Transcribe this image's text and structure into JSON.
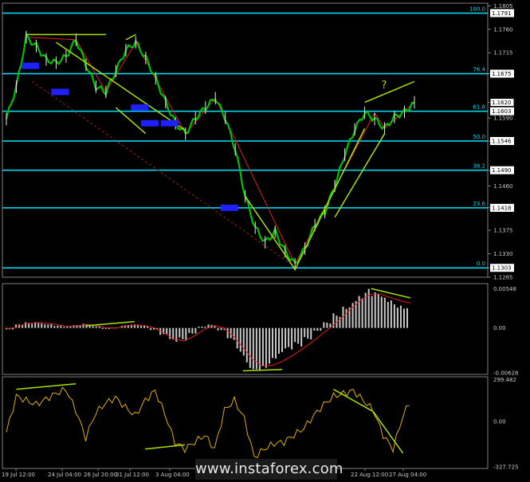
{
  "chart_data": [
    {
      "type": "line",
      "title": "",
      "price_ticks": [
        "1.1805",
        "1.1760",
        "1.1715",
        "1.1675",
        "1.1620",
        "1.1590",
        "1.1546",
        "1.1490",
        "1.1460",
        "1.1418",
        "1.1375",
        "1.1330",
        "1.1303",
        "1.1285"
      ],
      "ylim": [
        1.1285,
        1.181
      ],
      "current_price": "1.1620",
      "fibonacci_levels": [
        {
          "label": "100.0",
          "price": "1.1791",
          "value": 1.1791
        },
        {
          "label": "76.4",
          "price": "1.1675",
          "value": 1.1675
        },
        {
          "label": "61.8",
          "price": "1.1603",
          "value": 1.1603
        },
        {
          "label": "50.0",
          "price": "1.1546",
          "value": 1.1546
        },
        {
          "label": "38.2",
          "price": "1.1490",
          "value": 1.149
        },
        {
          "label": "23.6",
          "price": "1.1418",
          "value": 1.1418
        },
        {
          "label": "0.0",
          "price": "1.1303",
          "value": 1.1303
        }
      ],
      "series": [
        {
          "values": [
            1.1588,
            1.165,
            1.1745,
            1.1728,
            1.1702,
            1.1696,
            1.1708,
            1.174,
            1.1692,
            1.165,
            1.164,
            1.168,
            1.172,
            1.1735,
            1.1705,
            1.1666,
            1.162,
            1.158,
            1.156,
            1.159,
            1.161,
            1.1628,
            1.159,
            1.153,
            1.144,
            1.138,
            1.1352,
            1.1372,
            1.1335,
            1.131,
            1.134,
            1.1385,
            1.141,
            1.146,
            1.152,
            1.1568,
            1.16,
            1.1588,
            1.157,
            1.1592,
            1.1602,
            1.162
          ]
        }
      ],
      "annotation": "?"
    },
    {
      "type": "bar",
      "ylim": [
        -0.0065,
        0.0062
      ],
      "ticks": [
        "0.00548",
        "0.00",
        "-0.00628"
      ],
      "series": [
        {
          "values": [
            -0.0002,
            0.0005,
            0.0008,
            0.0009,
            0.0007,
            0.0004,
            0.0002,
            0.0004,
            0.0006,
            0.0003,
            -0.0002,
            0.0001,
            0.0004,
            0.0005,
            0.0003,
            -0.0003,
            -0.0012,
            -0.0022,
            -0.0018,
            -0.0008,
            0.0002,
            0.0005,
            -0.0004,
            -0.002,
            -0.004,
            -0.0058,
            -0.006,
            -0.0056,
            -0.0048,
            -0.0038,
            -0.0028,
            -0.0016,
            -0.0004,
            0.0008,
            0.0022,
            0.0038,
            0.005,
            0.0055,
            0.005,
            0.0044,
            0.004,
            0.0038
          ]
        }
      ]
    },
    {
      "type": "line",
      "ylim": [
        -340,
        320
      ],
      "ticks": [
        "299.482",
        "0.00",
        "-327.725"
      ],
      "series": [
        {
          "values": [
            -80,
            180,
            150,
            120,
            160,
            200,
            230,
            80,
            -120,
            60,
            130,
            170,
            100,
            40,
            150,
            220,
            50,
            -150,
            -200,
            -150,
            -100,
            -200,
            80,
            150,
            20,
            -260,
            -200,
            -160,
            -150,
            -100,
            -50,
            40,
            120,
            180,
            200,
            220,
            150,
            80,
            -100,
            -200,
            40,
            180
          ]
        }
      ]
    }
  ],
  "date_labels": [
    "19 Jul 12:00",
    "24 Jul 04:00",
    "26 Jul 20:00",
    "31 Jul 12:00",
    "3 Aug 04:00",
    "7 Aug 20:00",
    "22 Aug 12:00",
    "27 Aug 04:00"
  ],
  "watermark": "www.instaforex.com",
  "colors": {
    "price_line": "#00c000",
    "fib_line": "#00e5ff",
    "trend_line": "#a8e000",
    "signal_line": "#e02020",
    "osc_line": "#e0b000",
    "histogram": "#c8c8c8",
    "label_box": "#2020ff"
  }
}
